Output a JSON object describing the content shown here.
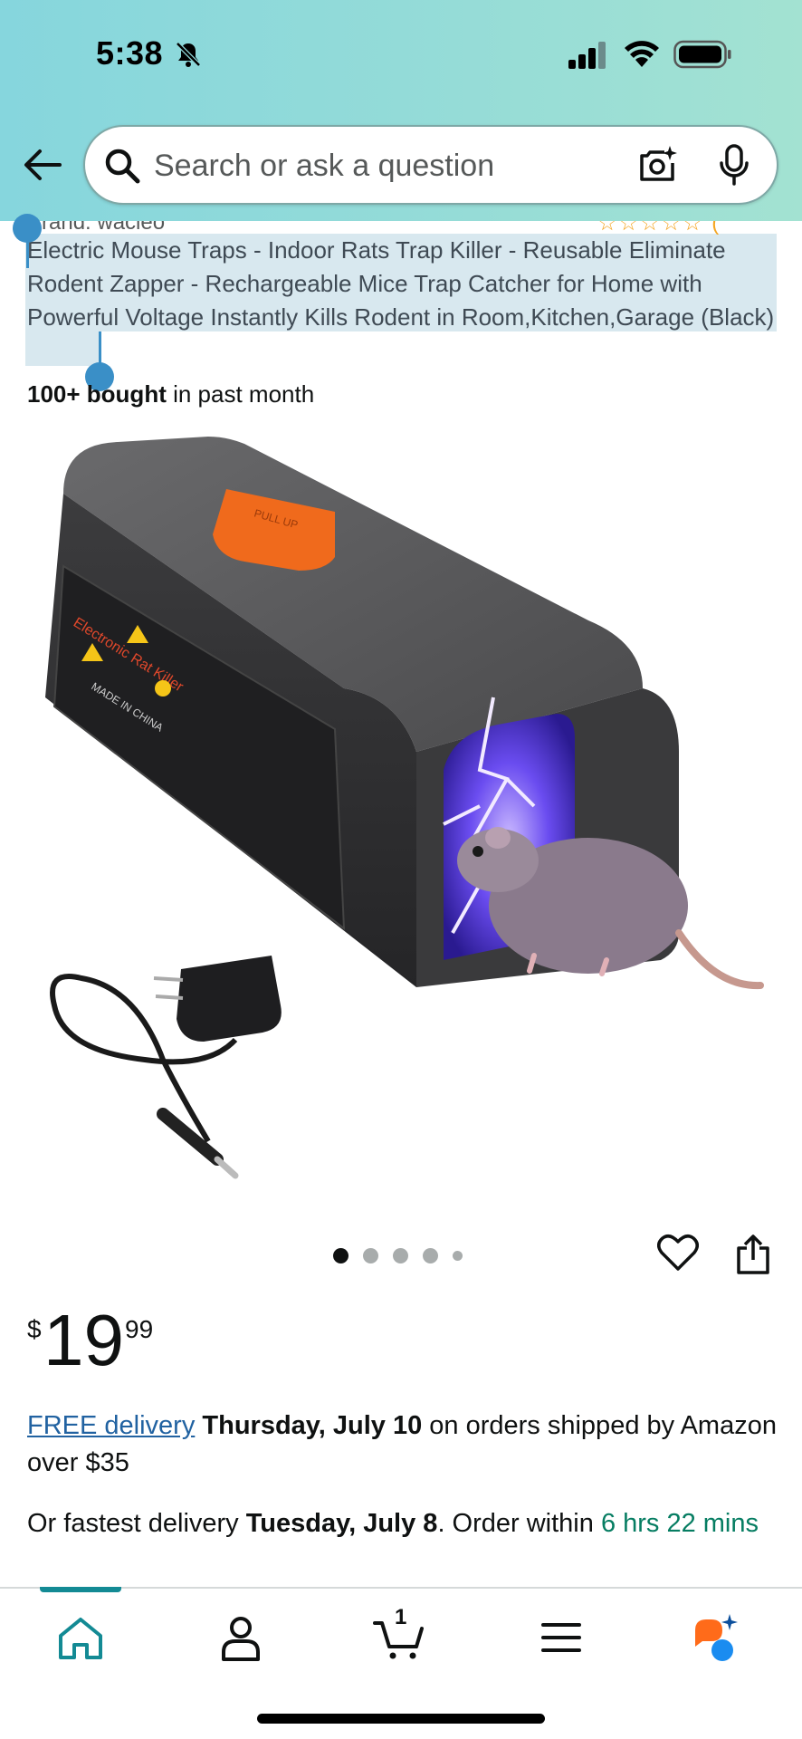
{
  "status_bar": {
    "time": "5:38"
  },
  "search": {
    "placeholder": "Search or ask a question"
  },
  "product": {
    "brand_line": "Brand: wacleo",
    "rating_stars": "☆☆☆☆☆ (",
    "title": "Electric Mouse Traps - Indoor Rats Trap Killer - Reusable Eliminate Rodent Zapper - Rechargeable Mice Trap Catcher for Home with Powerful Voltage Instantly Kills Rodent in Room,Kitchen,Garage (Black)",
    "bought_bold": "100+ bought",
    "bought_rest": " in past month",
    "image_labels": {
      "lid_text": "PULL UP",
      "side_label": "Electronic Rat Killer",
      "made_in": "MADE IN CHINA"
    },
    "carousel": {
      "count": 5,
      "active_index": 0
    }
  },
  "price": {
    "symbol": "$",
    "whole": "19",
    "fraction": "99"
  },
  "delivery": {
    "link": "FREE delivery",
    "date": "Thursday, July 10",
    "rest": " on orders shipped by Amazon over $35"
  },
  "fastest": {
    "prefix": "Or fastest delivery ",
    "date": "Tuesday, July 8",
    "middle": ". Order within ",
    "countdown": "6 hrs 22 mins"
  },
  "bottom_nav": {
    "items": [
      "home-icon",
      "account-icon",
      "cart-icon",
      "menu-icon",
      "rufus-ai-icon"
    ],
    "cart_count": "1",
    "active": "home-icon"
  },
  "colors": {
    "header_gradient_start": "#86d6dd",
    "header_gradient_end": "#a3e2d2",
    "link": "#2162a1",
    "countdown": "#067d62",
    "active_nav": "#138a94",
    "selection_handle": "#3a8fc7",
    "selection_bg": "#d8e8ef"
  }
}
